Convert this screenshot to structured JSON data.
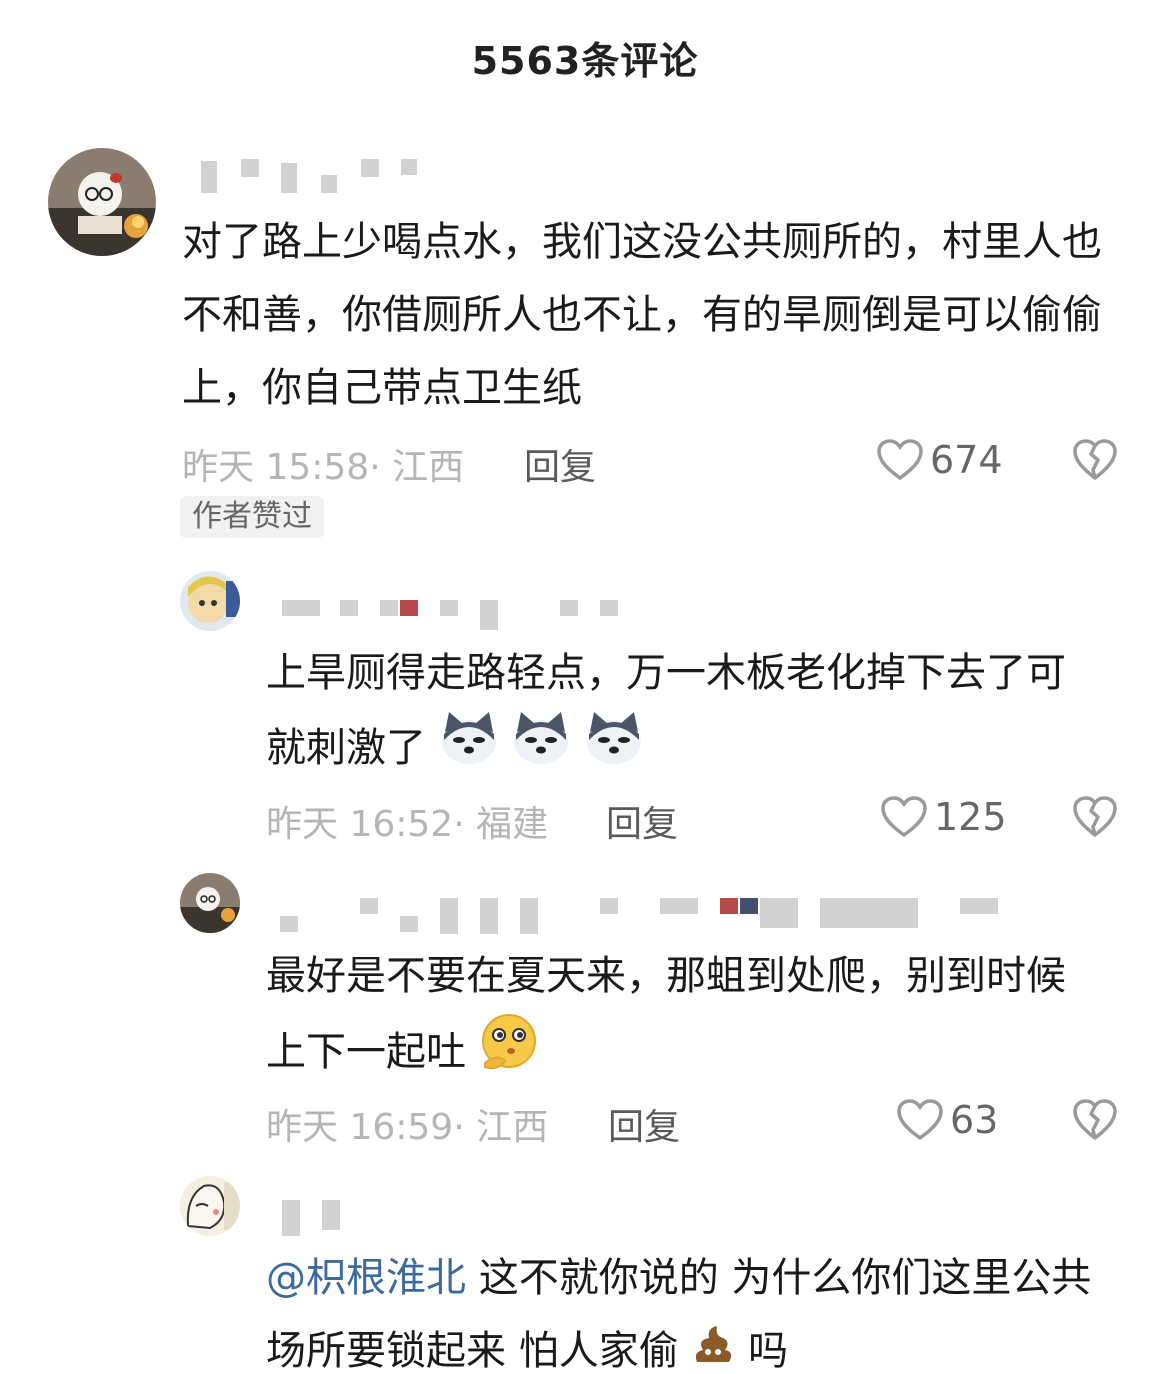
{
  "header": {
    "title": "5563条评论"
  },
  "comments": [
    {
      "text": "对了路上少喝点水，我们这没公共厕所的，村里人也不和善，你借厕所人也不让，有的旱厕倒是可以偷偷上，你自己带点卫生纸",
      "time_location": "昨天 15:58· 江西",
      "reply_label": "回复",
      "likes": "674",
      "badge": "作者赞过"
    },
    {
      "text": "上旱厕得走路轻点，万一木板老化掉下去了可就刺激了",
      "emojis": [
        "dog-emoji",
        "dog-emoji",
        "dog-emoji"
      ],
      "time_location": "昨天 16:52· 福建",
      "reply_label": "回复",
      "likes": "125"
    },
    {
      "text": "最好是不要在夏天来，那蛆到处爬，别到时候上下一起吐",
      "emojis": [
        "thinking-emoji"
      ],
      "time_location": "昨天 16:59· 江西",
      "reply_label": "回复",
      "likes": "63"
    },
    {
      "mention": "@枳根淮北",
      "text": " 这不就你说的 为什么你们这里公共场所要锁起来 怕人家偷",
      "emojis": [
        "poop-emoji"
      ],
      "text_tail": " 吗"
    }
  ],
  "icons": {
    "like": "heart-outline-icon",
    "dislike": "broken-heart-icon"
  }
}
